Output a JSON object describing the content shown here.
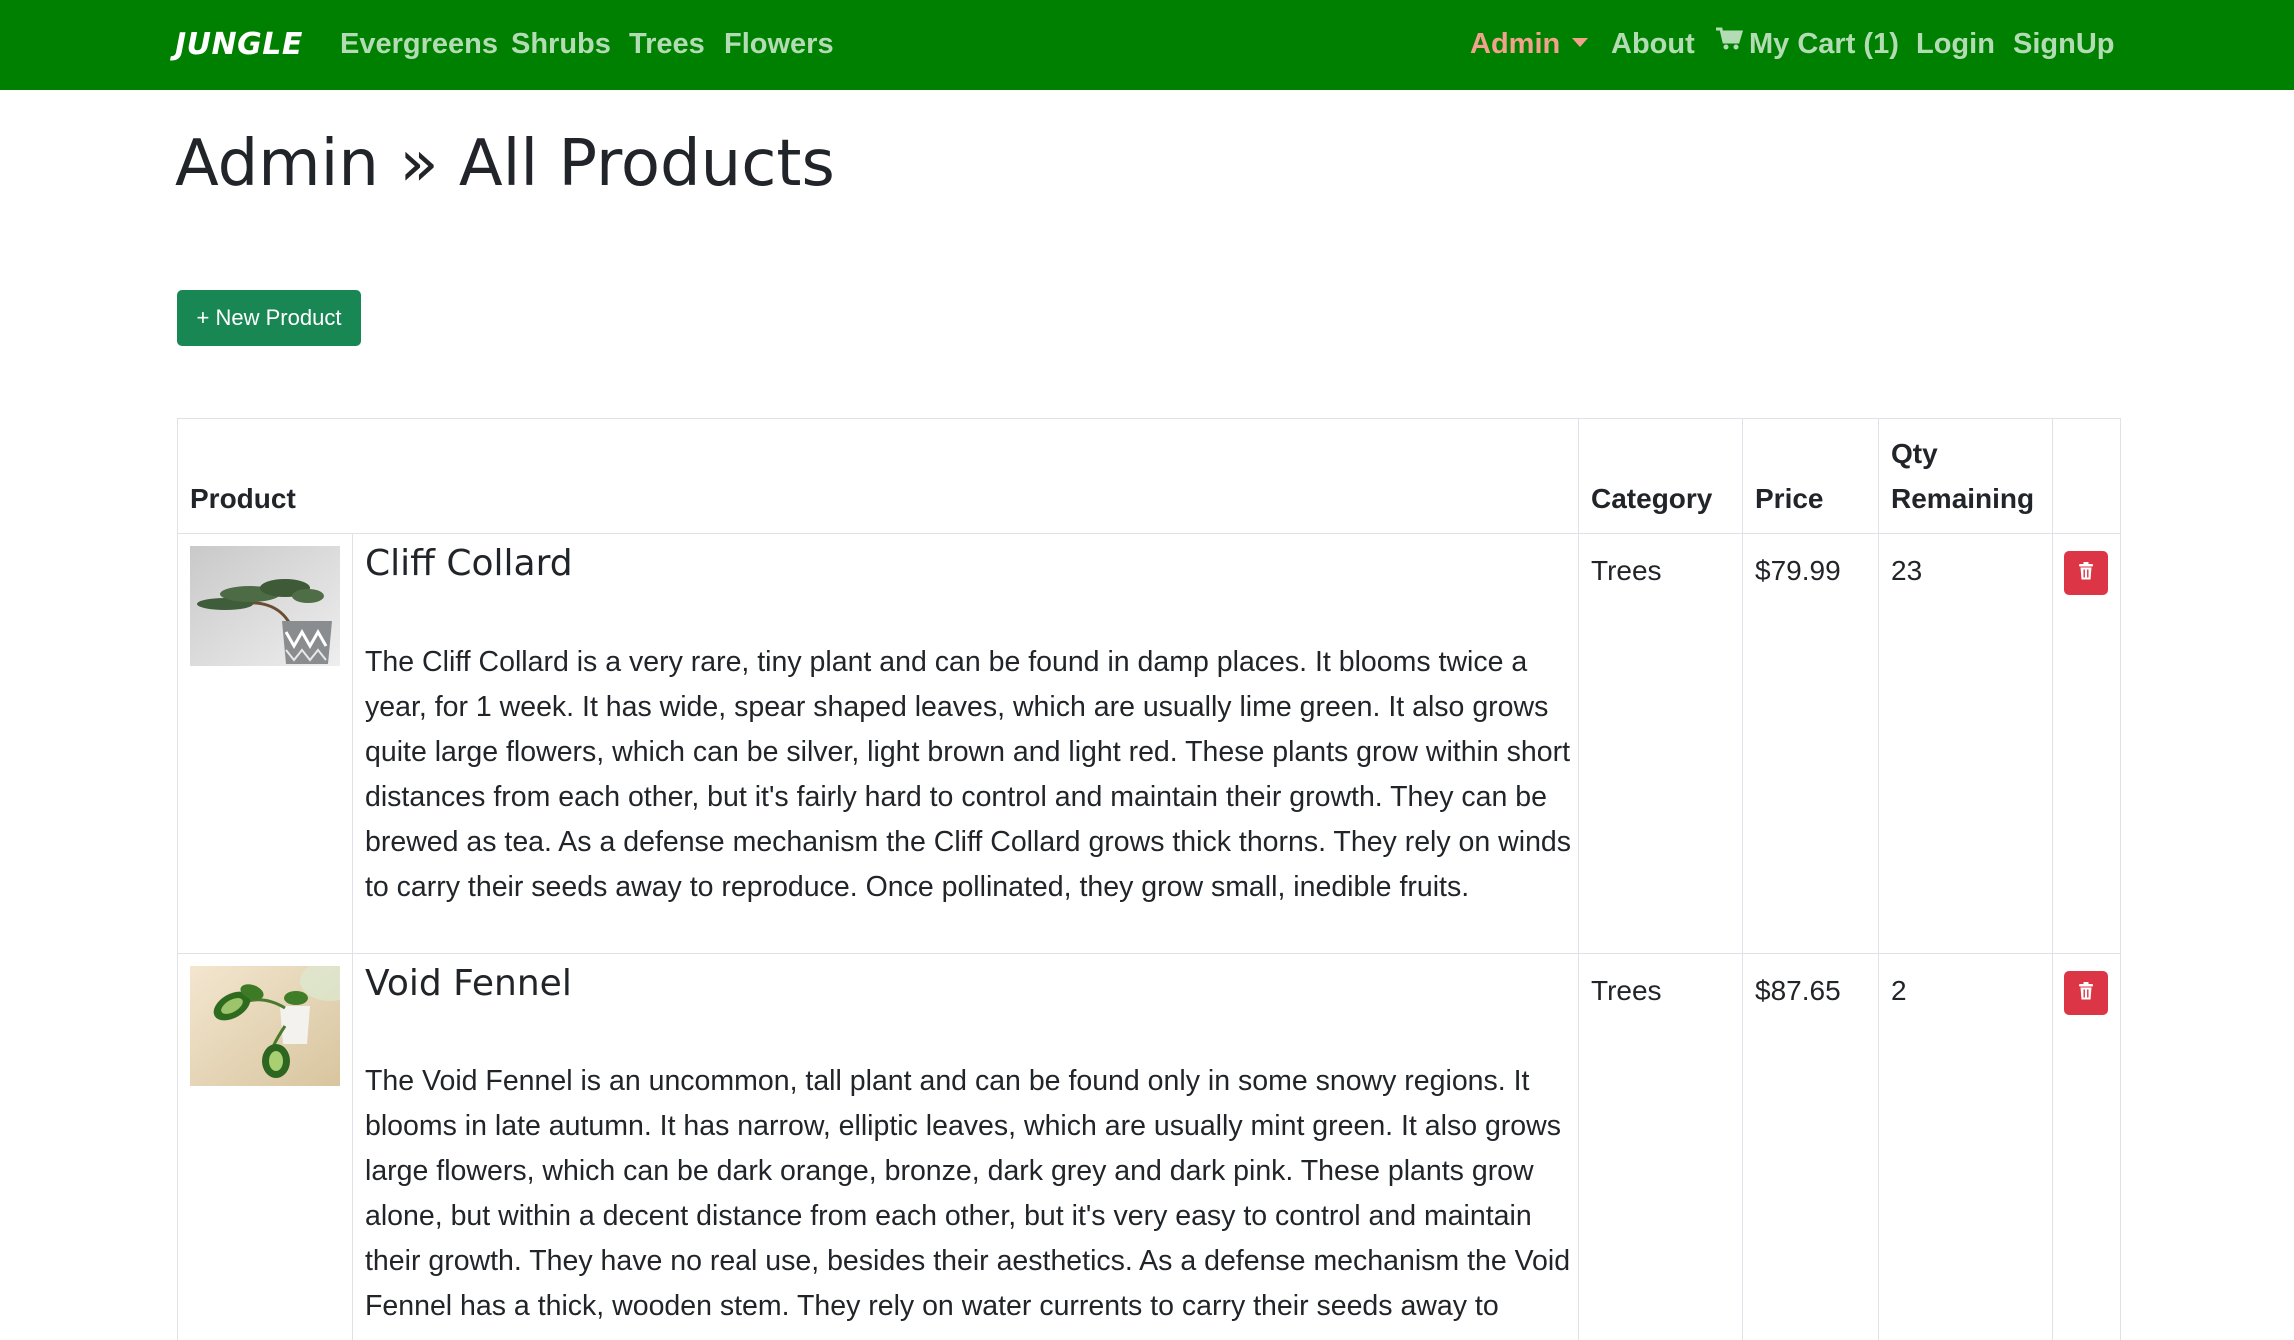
{
  "navbar": {
    "brand": "JUNGLE",
    "links": [
      "Evergreens",
      "Shrubs",
      "Trees",
      "Flowers"
    ],
    "admin": "Admin",
    "about": "About",
    "cart": "My Cart (1)",
    "login": "Login",
    "signup": "SignUp",
    "colors": {
      "background": "#008000",
      "link": "#b4dcb4",
      "admin": "#f0a38a"
    }
  },
  "page": {
    "title": "Admin » All Products",
    "new_product": "+ New Product"
  },
  "table": {
    "headers": {
      "product": "Product",
      "category": "Category",
      "price": "Price",
      "qty_1": "Qty",
      "qty_2": "Remaining"
    },
    "rows": [
      {
        "name": "Cliff Collard",
        "description": "The Cliff Collard is a very rare, tiny plant and can be found in damp places. It blooms twice a year, for 1 week. It has wide, spear shaped leaves, which are usually lime green. It also grows quite large flowers, which can be silver, light brown and light red. These plants grow within short distances from each other, but it's fairly hard to control and maintain their growth. They can be brewed as tea. As a defense mechanism the Cliff Collard grows thick thorns. They rely on winds to carry their seeds away to reproduce. Once pollinated, they grow small, inedible fruits.",
        "category": "Trees",
        "price": "$79.99",
        "qty": "23",
        "image": "bonsai-thumbnail"
      },
      {
        "name": "Void Fennel",
        "description": "The Void Fennel is an uncommon, tall plant and can be found only in some snowy regions. It blooms in late autumn. It has narrow, elliptic leaves, which are usually mint green. It also grows large flowers, which can be dark orange, bronze, dark grey and dark pink. These plants grow alone, but within a decent distance from each other, but it's very easy to control and maintain their growth. They have no real use, besides their aesthetics. As a defense mechanism the Void Fennel has a thick, wooden stem. They rely on water currents to carry their seeds away to",
        "category": "Trees",
        "price": "$87.65",
        "qty": "2",
        "image": "potted-plant-thumbnail"
      }
    ],
    "delete_color": "#dc3545"
  }
}
